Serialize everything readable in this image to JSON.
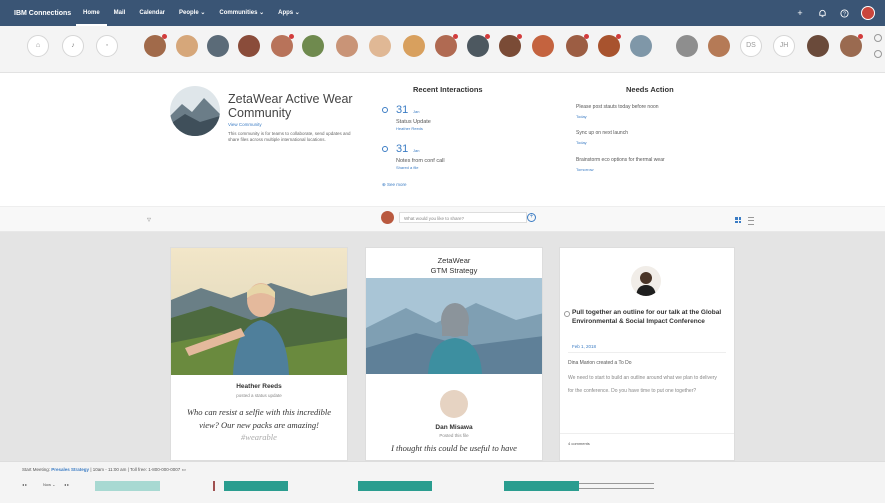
{
  "topbar": {
    "brand": "IBM Connections",
    "nav": [
      {
        "label": "Home",
        "active": true
      },
      {
        "label": "Mail",
        "active": false
      },
      {
        "label": "Calendar",
        "active": false
      },
      {
        "label": "People ⌄",
        "active": false
      },
      {
        "label": "Communities ⌄",
        "active": false
      },
      {
        "label": "Apps ⌄",
        "active": false
      }
    ],
    "icons": [
      "add-icon",
      "notifications-icon",
      "help-icon"
    ]
  },
  "people_bar": {
    "initials": [
      "DS",
      "JH"
    ]
  },
  "community": {
    "title": "ZetaWear Active Wear Community",
    "link": "View Community",
    "description": "This community is for teams to collaborate, send updates and share files across multiple international locations."
  },
  "recent_interactions": {
    "heading": "Recent Interactions",
    "items": [
      {
        "day": "31",
        "month": "Jan",
        "title": "Status Update",
        "sub": "Heather Reeds"
      },
      {
        "day": "31",
        "month": "Jan",
        "title": "Notes from conf call",
        "sub": "Shared a file"
      }
    ],
    "see_more": "See more"
  },
  "needs_action": {
    "heading": "Needs Action",
    "items": [
      {
        "text": "Please post stauts today before noon",
        "date": "Today"
      },
      {
        "text": "Sync up on next launch",
        "date": "Today"
      },
      {
        "text": "Brainstorm eco options for thermal wear",
        "date": "Tomorrow"
      }
    ]
  },
  "share": {
    "placeholder": "What would you like to share?"
  },
  "cards": {
    "card1": {
      "name": "Heather Reeds",
      "sub": "posted a status update",
      "quote": "Who can resist a selfie with this incredible view? Our new packs are amazing!",
      "tag": "#wearable"
    },
    "card2": {
      "title": "ZetaWear\nGTM Strategy",
      "name": "Dan Misawa",
      "sub": "Posted this file",
      "quote": "I thought this could be useful to have"
    },
    "card3": {
      "title": "Pull together an outline for our talk at the Global Environmental & Social Impact Conference",
      "date": "Feb 1, 2018",
      "author": "Dina Marion created a To Do",
      "body": "We need to start to build an outline around what we plan to delivery for the conference. Do you have time to put one together?",
      "comments": "4 comments"
    }
  },
  "meeting": {
    "prefix": "Start Meeting:",
    "title": "Presales Strategy",
    "details": "| 10am - 11:00 am | Toll free: 1-800-000-0007",
    "controls": "Now ⌄"
  },
  "colors": {
    "topbar": "#3a5575",
    "accent": "#3b7cc4",
    "timeline_teal": "#2a9d8f",
    "timeline_light": "#a8d9d2"
  }
}
